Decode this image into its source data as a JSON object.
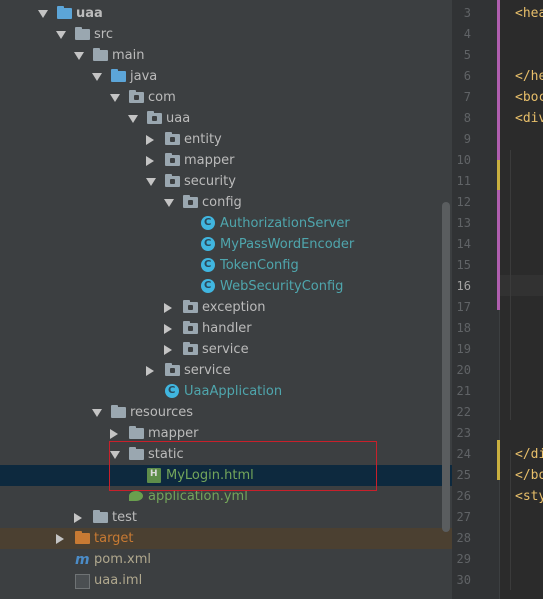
{
  "tree": [
    {
      "label": "uaa",
      "icon": "module-folder-icon",
      "arrow": "open",
      "indent": 40,
      "color": "default",
      "bold": true
    },
    {
      "label": "src",
      "icon": "folder-icon",
      "arrow": "open",
      "indent": 58
    },
    {
      "label": "main",
      "icon": "folder-icon",
      "arrow": "open",
      "indent": 76
    },
    {
      "label": "java",
      "icon": "source-folder-icon",
      "arrow": "open",
      "indent": 94
    },
    {
      "label": "com",
      "icon": "package-icon",
      "arrow": "open",
      "indent": 112
    },
    {
      "label": "uaa",
      "icon": "package-icon",
      "arrow": "open",
      "indent": 130
    },
    {
      "label": "entity",
      "icon": "package-icon",
      "arrow": "closed",
      "indent": 148
    },
    {
      "label": "mapper",
      "icon": "package-icon",
      "arrow": "closed",
      "indent": 148
    },
    {
      "label": "security",
      "icon": "package-icon",
      "arrow": "open",
      "indent": 148
    },
    {
      "label": "config",
      "icon": "package-icon",
      "arrow": "open",
      "indent": 166
    },
    {
      "label": "AuthorizationServer",
      "icon": "class-icon",
      "arrow": "none",
      "indent": 184,
      "color": "cyan"
    },
    {
      "label": "MyPassWordEncoder",
      "icon": "class-icon",
      "arrow": "none",
      "indent": 184,
      "color": "cyan"
    },
    {
      "label": "TokenConfig",
      "icon": "class-icon",
      "arrow": "none",
      "indent": 184,
      "color": "cyan"
    },
    {
      "label": "WebSecurityConfig",
      "icon": "class-icon",
      "arrow": "none",
      "indent": 184,
      "color": "cyan"
    },
    {
      "label": "exception",
      "icon": "package-icon",
      "arrow": "closed",
      "indent": 166
    },
    {
      "label": "handler",
      "icon": "package-icon",
      "arrow": "closed",
      "indent": 166
    },
    {
      "label": "service",
      "icon": "package-icon",
      "arrow": "closed",
      "indent": 166
    },
    {
      "label": "service",
      "icon": "package-icon",
      "arrow": "closed",
      "indent": 148
    },
    {
      "label": "UaaApplication",
      "icon": "springboot-class-icon",
      "arrow": "none",
      "indent": 148,
      "color": "cyan"
    },
    {
      "label": "resources",
      "icon": "resources-folder-icon",
      "arrow": "open",
      "indent": 94
    },
    {
      "label": "mapper",
      "icon": "folder-icon",
      "arrow": "closed",
      "indent": 112
    },
    {
      "label": "static",
      "icon": "folder-icon",
      "arrow": "open",
      "indent": 112
    },
    {
      "label": "MyLogin.html",
      "icon": "html-file-icon",
      "arrow": "none",
      "indent": 130,
      "color": "green",
      "selected": true
    },
    {
      "label": "application.yml",
      "icon": "yml-file-icon",
      "arrow": "none",
      "indent": 112,
      "color": "green"
    },
    {
      "label": "test",
      "icon": "folder-icon",
      "arrow": "closed",
      "indent": 76
    },
    {
      "label": "target",
      "icon": "excluded-folder-icon",
      "arrow": "closed",
      "indent": 58,
      "color": "orange",
      "target": true
    },
    {
      "label": "pom.xml",
      "icon": "maven-icon",
      "arrow": "none",
      "indent": 58,
      "color": "muted"
    },
    {
      "label": "uaa.iml",
      "icon": "iml-file-icon",
      "arrow": "none",
      "indent": 58,
      "color": "muted"
    }
  ],
  "line_numbers": [
    "3",
    "4",
    "5",
    "6",
    "7",
    "8",
    "9",
    "10",
    "11",
    "12",
    "13",
    "14",
    "15",
    "16",
    "17",
    "18",
    "19",
    "20",
    "21",
    "22",
    "23",
    "24",
    "25",
    "26",
    "27",
    "28",
    "29",
    "30"
  ],
  "current_line": "16",
  "code_fragments": [
    {
      "line": "3",
      "text": "<hea"
    },
    {
      "line": "6",
      "text": "</he"
    },
    {
      "line": "7",
      "text": "<boc"
    },
    {
      "line": "8",
      "text": "<div"
    },
    {
      "line": "24",
      "text": "</di"
    },
    {
      "line": "25",
      "text": "</bo"
    },
    {
      "line": "26",
      "text": "<sty"
    }
  ],
  "colors": {
    "tree_bg": "#3c3f41",
    "selection": "#0d293e",
    "highlight_box": "#c8202b",
    "editor_bg": "#2b2b2b",
    "gutter_bg": "#313335",
    "tag": "#e8bf6a",
    "vcs_changed": "#b05fb0",
    "vcs_added": "#c9b040"
  }
}
